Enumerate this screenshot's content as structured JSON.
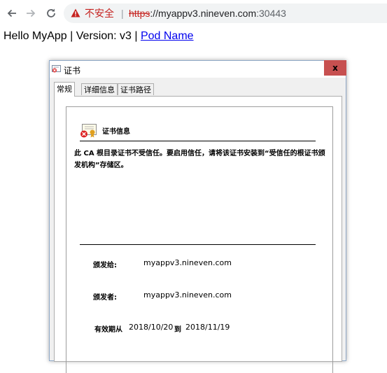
{
  "browser": {
    "security_label": "不安全",
    "separator": "|",
    "url_scheme": "https",
    "url_host": "://myappv3.nineven.com",
    "url_port": ":30443"
  },
  "page": {
    "hello_text": "Hello MyApp | Version: v3 | ",
    "pod_link": "Pod Name"
  },
  "dialog": {
    "title": "证书",
    "close_label": "x",
    "tabs": [
      {
        "label": "常规",
        "active": true
      },
      {
        "label": "详细信息",
        "active": false
      },
      {
        "label": "证书路径",
        "active": false
      }
    ],
    "section_title": "证书信息",
    "warning": "此 CA 根目录证书不受信任。要启用信任，请将该证书安装到“受信任的根证书颁发机构”存储区。",
    "issued_to_label": "颁发给:",
    "issued_to_value": "myappv3.nineven.com",
    "issued_by_label": "颁发者:",
    "issued_by_value": "myappv3.nineven.com",
    "validity_label": "有效期从",
    "valid_from": "2018/10/20",
    "to_label": "到",
    "valid_to": "2018/11/19"
  },
  "colors": {
    "insecure_red": "#c5221f",
    "link_blue": "#0000ee",
    "close_button": "#c75050"
  }
}
